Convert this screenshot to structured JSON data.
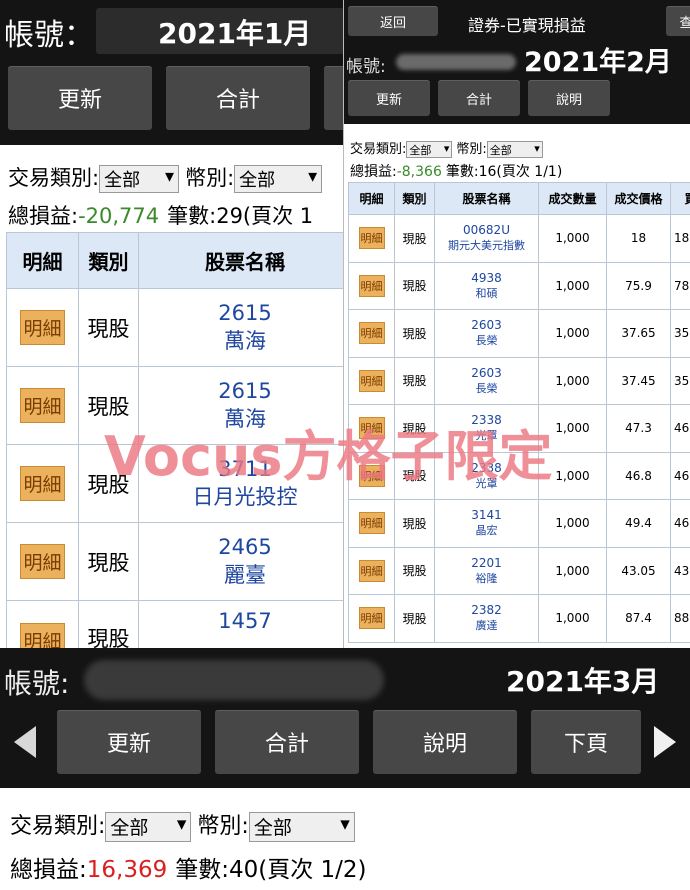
{
  "jan": {
    "account_label": "帳號：",
    "month": "2021年1月",
    "buttons": {
      "update": "更新",
      "total": "合計"
    },
    "filter": {
      "type_label": "交易類別:",
      "type_value": "全部",
      "currency_label": "幣別:",
      "currency_value": "全部"
    },
    "summary": {
      "label": "總損益:",
      "value": "-20,774",
      "count": "筆數:29(頁次 1"
    },
    "table": {
      "headers": [
        "明細",
        "類別",
        "股票名稱"
      ],
      "rows": [
        {
          "detail": "明細",
          "type": "現股",
          "code": "2615",
          "name": "萬海"
        },
        {
          "detail": "明細",
          "type": "現股",
          "code": "2615",
          "name": "萬海"
        },
        {
          "detail": "明細",
          "type": "現股",
          "code": "3711",
          "name": "日月光投控"
        },
        {
          "detail": "明細",
          "type": "現股",
          "code": "2465",
          "name": "麗臺"
        },
        {
          "detail": "明細",
          "type": "現股",
          "code": "1457",
          "name": ""
        }
      ]
    }
  },
  "feb": {
    "back": "返回",
    "title": "證券-已實現損益",
    "query": "查",
    "account_label": "帳號:",
    "month": "2021年2月",
    "buttons": {
      "update": "更新",
      "total": "合計",
      "help": "說明"
    },
    "filter": {
      "type_label": "交易類別:",
      "type_value": "全部",
      "currency_label": "幣別:",
      "currency_value": "全部"
    },
    "summary": {
      "label": "總損益:",
      "value": "-8,366",
      "count": "筆數:16(頁次 1/1)"
    },
    "table": {
      "headers": [
        "明細",
        "類別",
        "股票名稱",
        "成交數量",
        "成交價格",
        "買"
      ],
      "rows": [
        {
          "detail": "明細",
          "type": "現股",
          "code": "00682U",
          "name": "期元大美元指數",
          "qty": "1,000",
          "price": "18",
          "buy": "18"
        },
        {
          "detail": "明細",
          "type": "現股",
          "code": "4938",
          "name": "和碩",
          "qty": "1,000",
          "price": "75.9",
          "buy": "78"
        },
        {
          "detail": "明細",
          "type": "現股",
          "code": "2603",
          "name": "長榮",
          "qty": "1,000",
          "price": "37.65",
          "buy": "35"
        },
        {
          "detail": "明細",
          "type": "現股",
          "code": "2603",
          "name": "長榮",
          "qty": "1,000",
          "price": "37.45",
          "buy": "35"
        },
        {
          "detail": "明細",
          "type": "現股",
          "code": "2338",
          "name": "光罩",
          "qty": "1,000",
          "price": "47.3",
          "buy": "46"
        },
        {
          "detail": "明細",
          "type": "現股",
          "code": "2338",
          "name": "光罩",
          "qty": "1,000",
          "price": "46.8",
          "buy": "46"
        },
        {
          "detail": "明細",
          "type": "現股",
          "code": "3141",
          "name": "晶宏",
          "qty": "1,000",
          "price": "49.4",
          "buy": "46"
        },
        {
          "detail": "明細",
          "type": "現股",
          "code": "2201",
          "name": "裕隆",
          "qty": "1,000",
          "price": "43.05",
          "buy": "43"
        },
        {
          "detail": "明細",
          "type": "現股",
          "code": "2382",
          "name": "廣達",
          "qty": "1,000",
          "price": "87.4",
          "buy": "88"
        }
      ]
    }
  },
  "mar": {
    "account_label": "帳號:",
    "month": "2021年3月",
    "buttons": {
      "update": "更新",
      "total": "合計",
      "help": "說明",
      "next": "下頁"
    },
    "filter": {
      "type_label": "交易類別:",
      "type_value": "全部",
      "currency_label": "幣別:",
      "currency_value": "全部"
    },
    "summary": {
      "label": "總損益:",
      "value": "16,369",
      "count": "筆數:40(頁次 1/2)"
    }
  },
  "watermark": "Vocus方格子限定",
  "colors": {
    "detail_button": "#ebb15d",
    "header_bg": "#dce8f5",
    "loss_green": "#3a8a2a",
    "profit_red": "#d82020",
    "watermark": "#ec7882"
  }
}
